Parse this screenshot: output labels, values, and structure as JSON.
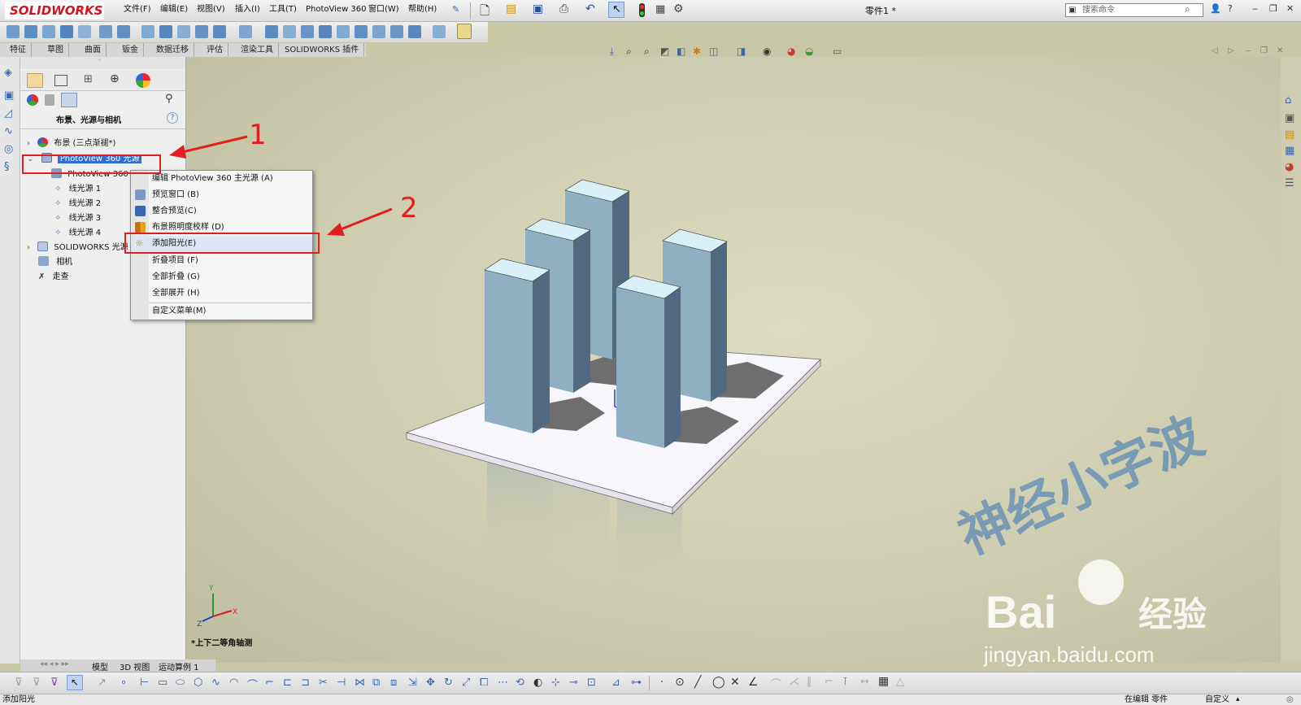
{
  "app": {
    "logo_text": "SOLIDWORKS",
    "menu": [
      "文件(F)",
      "编辑(E)",
      "视图(V)",
      "插入(I)",
      "工具(T)",
      "PhotoView 360",
      "窗口(W)",
      "帮助(H)"
    ],
    "document_title": "零件1 *",
    "search_placeholder": "搜索命令"
  },
  "command_tabs": [
    "特征",
    "草图",
    "曲面",
    "钣金",
    "数据迁移",
    "评估",
    "渲染工具",
    "SOLIDWORKS 插件"
  ],
  "panel": {
    "title": "布景、光源与相机",
    "tree": [
      {
        "label": "布景 (三点渐褪*)",
        "expanded": false
      },
      {
        "label": "PhotoView 360 光源",
        "expanded": true,
        "selected": true
      },
      {
        "label": "PhotoView 360"
      },
      {
        "label": "线光源 1"
      },
      {
        "label": "线光源 2"
      },
      {
        "label": "线光源 3"
      },
      {
        "label": "线光源 4"
      },
      {
        "label": "SOLIDWORKS 光源"
      },
      {
        "label": "相机"
      },
      {
        "label": "走查"
      }
    ]
  },
  "context_menu": {
    "items": [
      {
        "label": "编辑 PhotoView 360 主光源 (A)"
      },
      {
        "label": "预览窗口 (B)"
      },
      {
        "label": "整合预览(C)"
      },
      {
        "label": "布景照明度校样 (D)"
      },
      {
        "label": "添加阳光(E)",
        "highlighted": true
      },
      {
        "label": "折叠项目 (F)"
      },
      {
        "label": "全部折叠 (G)"
      },
      {
        "label": "全部展开 (H)"
      },
      {
        "label": "自定义菜单(M)"
      }
    ]
  },
  "annotations": {
    "marker_1": "1",
    "marker_2": "2",
    "color": "#e21e1e"
  },
  "viewport": {
    "view_label": "*上下二等角轴测",
    "triad_labels": [
      "Y",
      "X",
      "Z"
    ]
  },
  "bottom_tabs": [
    "模型",
    "3D 视图",
    "运动算例 1"
  ],
  "status": {
    "left": "添加阳光",
    "right_editing": "在编辑 零件",
    "right_custom": "自定义"
  },
  "watermark": {
    "script_text": "神经小字波",
    "brand": "Bai",
    "brand2": "经验",
    "url": "jingyan.baidu.com"
  },
  "colors": {
    "box_face": "#8fb0c2",
    "box_side": "#516a82",
    "box_top": "#d9f1f6",
    "accent": "#2f6fd4"
  }
}
